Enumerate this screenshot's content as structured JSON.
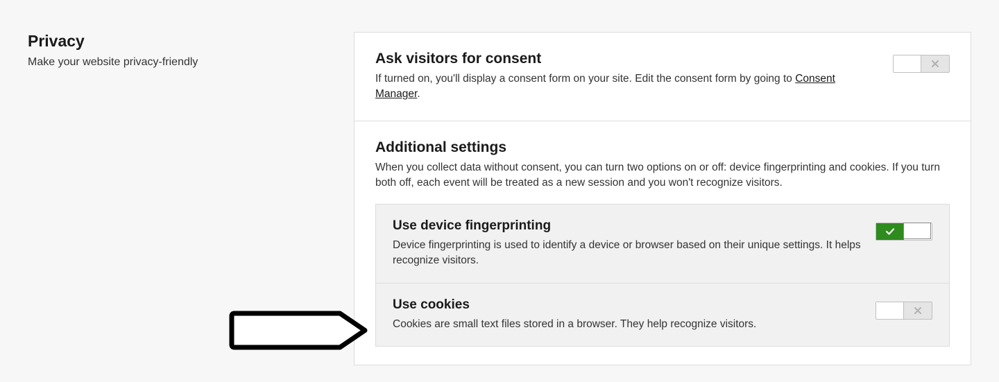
{
  "sidebar": {
    "title": "Privacy",
    "subtitle": "Make your website privacy-friendly"
  },
  "consent": {
    "title": "Ask visitors for consent",
    "desc_prefix": "If turned on, you'll display a consent form on your site. Edit the consent form by going to ",
    "link_label": "Consent Manager",
    "desc_suffix": ".",
    "toggle_state": "off"
  },
  "additional": {
    "title": "Additional settings",
    "desc": "When you collect data without consent, you can turn two options on or off: device fingerprinting and cookies. If you turn both off, each event will be treated as a new session and you won't recognize visitors.",
    "items": [
      {
        "title": "Use device fingerprinting",
        "desc": "Device fingerprinting is used to identify a device or browser based on their unique settings. It helps recognize visitors.",
        "toggle_state": "on"
      },
      {
        "title": "Use cookies",
        "desc": "Cookies are small text files stored in a browser. They help recognize visitors.",
        "toggle_state": "off"
      }
    ]
  }
}
